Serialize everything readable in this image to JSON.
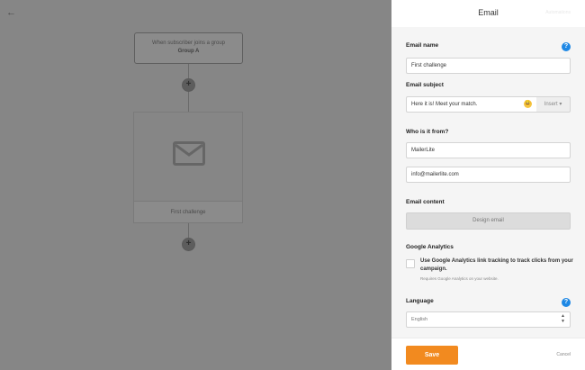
{
  "canvas": {
    "back_icon": "←",
    "trigger": {
      "line1": "When subscriber joins a group",
      "group": "Group A"
    },
    "plus_label": "+",
    "email_node": {
      "icon": "envelope-icon",
      "name": "First challenge"
    }
  },
  "panel": {
    "title": "Email",
    "header_link": "Automations",
    "email_name": {
      "label": "Email name",
      "value": "First challenge"
    },
    "email_subject": {
      "label": "Email subject",
      "value": "Here it is! Meet your match.",
      "emoji": "😀",
      "insert_label": "Insert ▾"
    },
    "from": {
      "label": "Who is it from?",
      "name_value": "MailerLite",
      "email_value": "info@mailerlite.com"
    },
    "content": {
      "label": "Email content",
      "design_label": "Design email"
    },
    "analytics": {
      "label": "Google Analytics",
      "checkbox_text": "Use Google Analytics link tracking to track clicks from your campaign.",
      "sub_text": "Requires Google Analytics on your website.",
      "checked": false
    },
    "language": {
      "label": "Language",
      "value": "English",
      "arrows": "⌃⌄"
    },
    "help_icon": "?",
    "footer": {
      "save_label": "Save",
      "cancel_label": "Cancel"
    }
  },
  "colors": {
    "accent": "#f28a1f",
    "help": "#1e88e5",
    "overlay": "#868686"
  }
}
